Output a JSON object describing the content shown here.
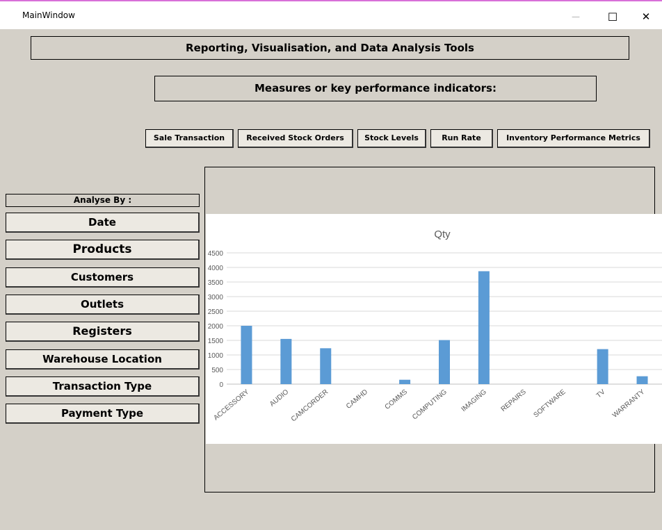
{
  "window": {
    "title": "MainWindow",
    "minimize_glyph": "—",
    "maximize_glyph": "☐",
    "close_glyph": "✕"
  },
  "header": {
    "title": "Reporting, Visualisation, and Data Analysis Tools"
  },
  "kpi": {
    "label": "Measures or key performance indicators:",
    "buttons": [
      "Sale Transaction",
      "Received Stock Orders",
      "Stock Levels",
      "Run Rate",
      "Inventory Performance Metrics"
    ]
  },
  "sidebar": {
    "label": "Analyse By :",
    "items": [
      "Date",
      "Products",
      "Customers",
      "Outlets",
      "Registers",
      "Warehouse Location",
      "Transaction Type",
      "Payment Type"
    ]
  },
  "chart_data": {
    "type": "bar",
    "title": "Qty",
    "categories": [
      "ACCESSORY",
      "AUDIO",
      "CAMCORDER",
      "CAMHD",
      "COMMS",
      "COMPUTING",
      "IMAGING",
      "REPAIRS",
      "SOFTWARE",
      "TV",
      "WARRANTY"
    ],
    "values": [
      2000,
      1550,
      1230,
      0,
      150,
      1510,
      3870,
      0,
      0,
      1200,
      270
    ],
    "ylim": [
      0,
      4500
    ],
    "yticks": [
      "0",
      "500",
      "1000",
      "1500",
      "2000",
      "2500",
      "3000",
      "3500",
      "4000",
      "4500"
    ],
    "grid": true,
    "bar_color": "#5b9bd5"
  }
}
